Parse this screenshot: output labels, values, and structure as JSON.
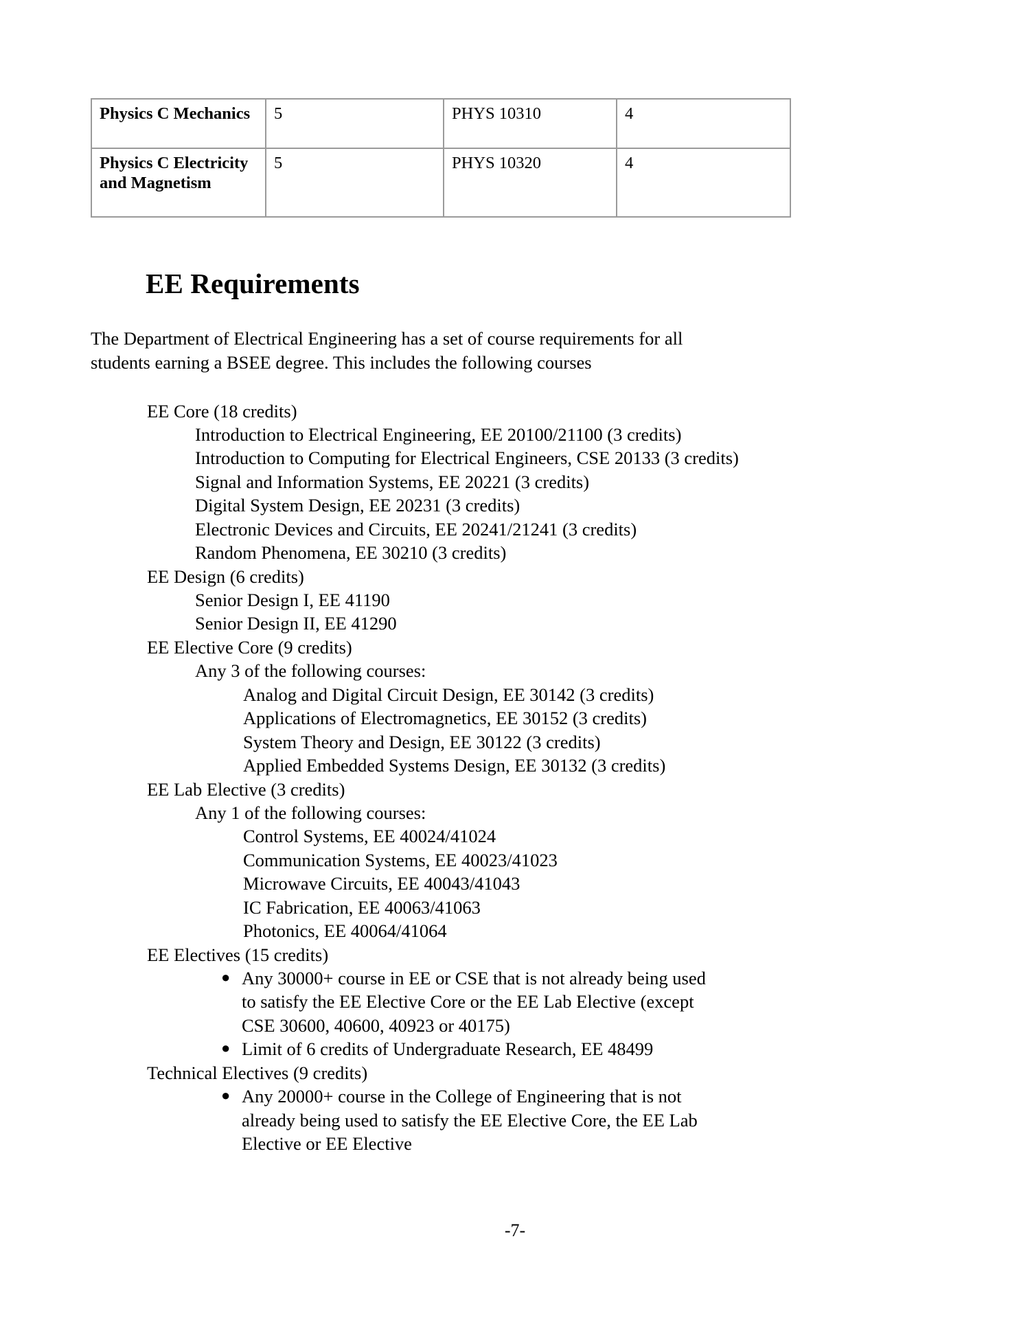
{
  "document": {
    "page_number": "-7-"
  },
  "ap_table": {
    "rows": [
      {
        "exam": "Physics C Mechanics",
        "score": "5",
        "course": "PHYS 10310",
        "credits": "4"
      },
      {
        "exam": "Physics C Electricity and Magnetism",
        "score": "5",
        "course": "PHYS 10320",
        "credits": "4"
      }
    ]
  },
  "section": {
    "heading": "EE Requirements",
    "intro": "The Department of Electrical Engineering has a set of course requirements for all students earning a BSEE degree. This includes the following courses"
  },
  "requirements": {
    "ee_core": {
      "title": "EE Core (18 credits)",
      "courses": [
        "Introduction to Electrical Engineering, EE 20100/21100 (3 credits)",
        "Introduction to Computing for Electrical Engineers, CSE 20133 (3 credits)",
        "Signal and Information Systems, EE 20221 (3 credits)",
        "Digital System Design, EE 20231 (3 credits)",
        "Electronic Devices and Circuits, EE 20241/21241 (3 credits)",
        "Random Phenomena, EE 30210 (3 credits)"
      ]
    },
    "ee_design": {
      "title": "EE Design (6 credits)",
      "courses": [
        "Senior Design I, EE 41190",
        "Senior Design II, EE 41290"
      ]
    },
    "ee_elective_core": {
      "title": "EE Elective Core (9 credits)",
      "subtitle": "Any 3 of the following courses:",
      "courses": [
        "Analog and Digital Circuit Design, EE 30142 (3 credits)",
        "Applications of Electromagnetics, EE 30152 (3 credits)",
        "System Theory and Design, EE 30122 (3 credits)",
        "Applied Embedded Systems Design, EE 30132 (3 credits)"
      ]
    },
    "ee_lab_elective": {
      "title": "EE Lab Elective (3 credits)",
      "subtitle": "Any 1 of the following courses:",
      "courses": [
        "Control Systems, EE 40024/41024",
        "Communication Systems, EE 40023/41023",
        "Microwave Circuits, EE 40043/41043",
        "IC Fabrication, EE 40063/41063",
        "Photonics, EE 40064/41064"
      ]
    },
    "ee_electives": {
      "title": "EE Electives (15 credits)",
      "bullets": [
        "Any 30000+ course in EE or CSE that is not already being used to satisfy the EE Elective Core or the EE Lab Elective (except CSE 30600, 40600, 40923 or 40175)",
        "Limit of 6 credits of Undergraduate Research, EE 48499"
      ]
    },
    "technical_electives": {
      "title": "Technical Electives (9 credits)",
      "bullets": [
        "Any 20000+ course in the College of Engineering that is not already being used to satisfy the EE Elective Core, the EE Lab Elective or EE Elective"
      ]
    }
  },
  "bullet_glyph": "●"
}
